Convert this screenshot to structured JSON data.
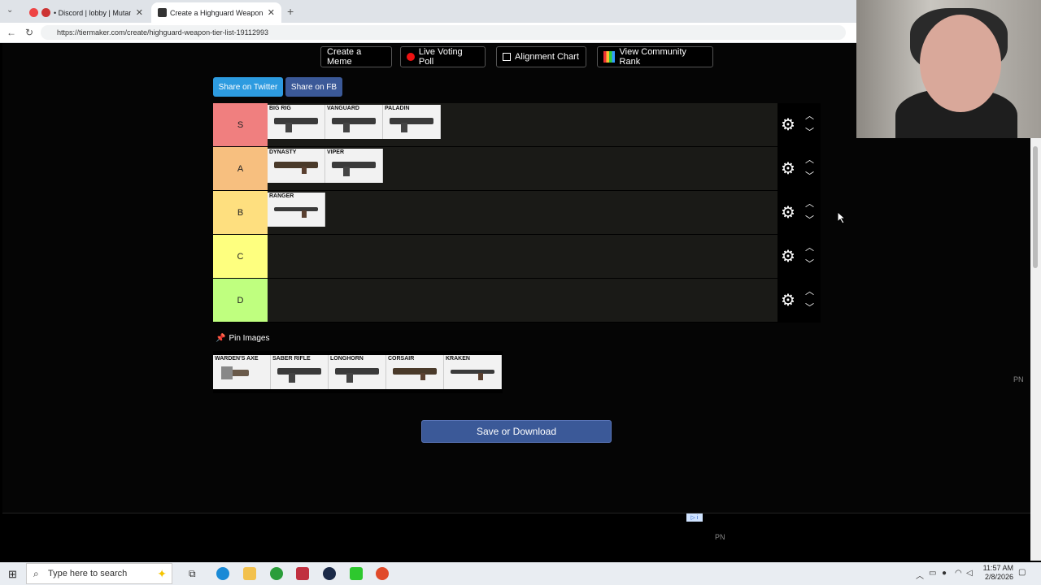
{
  "browser": {
    "tabs": [
      {
        "title": "• Discord | lobby | MutantBray",
        "active": false
      },
      {
        "title": "Create a Highguard Weapon Tier L",
        "active": true
      }
    ],
    "url": "https://tiermaker.com/create/highguard-weapon-tier-list-19112993"
  },
  "toolbar": {
    "create_meme": "Create a Meme",
    "live_voting": "Live Voting Poll",
    "alignment_chart": "Alignment Chart",
    "community_rank": "View Community Rank"
  },
  "share": {
    "twitter": "Share on Twitter",
    "fb": "Share on FB"
  },
  "tiers": [
    {
      "label": "S",
      "color": "#f07f7f",
      "items": [
        "BIG RIG",
        "VANGUARD",
        "PALADIN"
      ]
    },
    {
      "label": "A",
      "color": "#f7bf7f",
      "items": [
        "DYNASTY",
        "VIPER"
      ]
    },
    {
      "label": "B",
      "color": "#fedf7f",
      "items": [
        "RANGER"
      ]
    },
    {
      "label": "C",
      "color": "#feff7f",
      "items": []
    },
    {
      "label": "D",
      "color": "#bfff7f",
      "items": []
    }
  ],
  "pool": {
    "label": "Pin Images",
    "items": [
      "WARDEN'S AXE",
      "SABER RIFLE",
      "LONGHORN",
      "CORSAIR",
      "KRAKEN"
    ]
  },
  "save_button": "Save or Download",
  "watermark": "PN",
  "taskbar": {
    "search_placeholder": "Type here to search",
    "time": "11:57 AM",
    "date": "2/8/2026"
  }
}
